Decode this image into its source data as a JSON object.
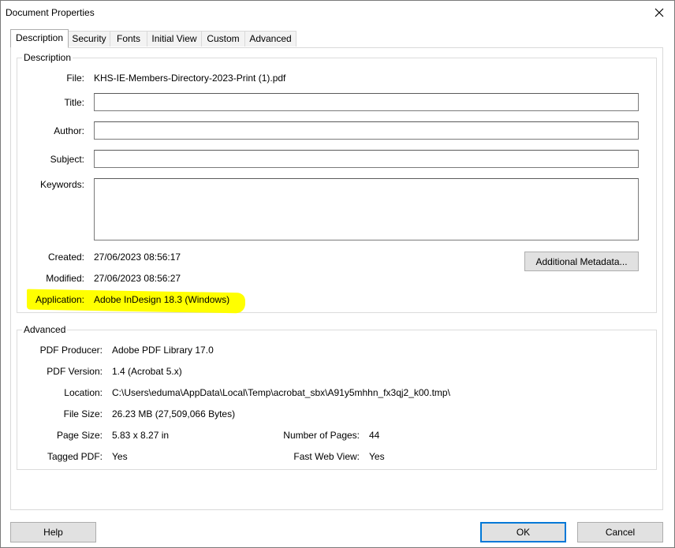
{
  "window": {
    "title": "Document Properties"
  },
  "tabs": [
    "Description",
    "Security",
    "Fonts",
    "Initial View",
    "Custom",
    "Advanced"
  ],
  "description": {
    "group_title": "Description",
    "file_label": "File:",
    "file_value": "KHS-IE-Members-Directory-2023-Print (1).pdf",
    "title_label": "Title:",
    "title_value": "",
    "author_label": "Author:",
    "author_value": "",
    "subject_label": "Subject:",
    "subject_value": "",
    "keywords_label": "Keywords:",
    "keywords_value": "",
    "created_label": "Created:",
    "created_value": "27/06/2023 08:56:17",
    "modified_label": "Modified:",
    "modified_value": "27/06/2023 08:56:27",
    "application_label": "Application:",
    "application_value": "Adobe InDesign 18.3 (Windows)",
    "additional_metadata_button": "Additional Metadata..."
  },
  "advanced": {
    "group_title": "Advanced",
    "pdf_producer_label": "PDF Producer:",
    "pdf_producer_value": "Adobe PDF Library 17.0",
    "pdf_version_label": "PDF Version:",
    "pdf_version_value": "1.4 (Acrobat 5.x)",
    "location_label": "Location:",
    "location_value": "C:\\Users\\eduma\\AppData\\Local\\Temp\\acrobat_sbx\\A91y5mhhn_fx3qj2_k00.tmp\\",
    "file_size_label": "File Size:",
    "file_size_value": "26.23 MB (27,509,066 Bytes)",
    "page_size_label": "Page Size:",
    "page_size_value": "5.83 x 8.27 in",
    "num_pages_label": "Number of Pages:",
    "num_pages_value": "44",
    "tagged_pdf_label": "Tagged PDF:",
    "tagged_pdf_value": "Yes",
    "fast_web_view_label": "Fast Web View:",
    "fast_web_view_value": "Yes"
  },
  "buttons": {
    "help": "Help",
    "ok": "OK",
    "cancel": "Cancel"
  },
  "colors": {
    "highlight": "#ffff00",
    "primary_border": "#0078d7"
  }
}
